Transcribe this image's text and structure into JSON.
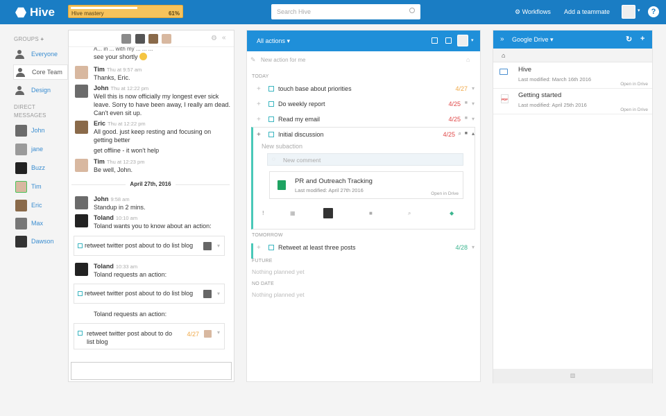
{
  "app": {
    "name": "Hive"
  },
  "topbar": {
    "mastery_label": "Hive mastery",
    "mastery_percent": "61%",
    "mastery_value": 0.61,
    "search_placeholder": "Search Hive",
    "workflows": "Workflows",
    "add_teammate": "Add a teammate",
    "help": "?"
  },
  "sidebar": {
    "groups_label": "GROUPS",
    "add_icon": "+",
    "groups": [
      {
        "label": "Everyone"
      },
      {
        "label": "Core Team"
      },
      {
        "label": "Design"
      }
    ],
    "dm_label_1": "DIRECT",
    "dm_label_2": "MESSAGES",
    "dms": [
      {
        "label": "John"
      },
      {
        "label": "jane"
      },
      {
        "label": "Buzz"
      },
      {
        "label": "Tim"
      },
      {
        "label": "Eric"
      },
      {
        "label": "Max"
      },
      {
        "label": "Dawson"
      }
    ]
  },
  "chat": {
    "partial_line1": "A... in ... with my ... ... ...",
    "partial_line2": "see your shortly",
    "messages": [
      {
        "name": "Tim",
        "time": "Thu at 9:57 am",
        "text": [
          "Thanks, Eric."
        ]
      },
      {
        "name": "John",
        "time": "Thu at 12:22 pm",
        "text": [
          "Well this is now officially my longest ever sick",
          "leave. Sorry to have been away, I really am dead.",
          "Can't even sit up."
        ]
      },
      {
        "name": "Eric",
        "time": "Thu at 12:22 pm",
        "text": [
          "All good. just keep resting and focusing on",
          "getting better"
        ]
      },
      {
        "name": "",
        "time": "",
        "text": [
          "get offline - it won't help"
        ]
      },
      {
        "name": "Tim",
        "time": "Thu at 12:23 pm",
        "text": [
          "Be well, John."
        ]
      }
    ],
    "day": "April 27th, 2016",
    "messages2": [
      {
        "name": "John",
        "time": "9:58 am",
        "text": "Standup in 2 mins."
      },
      {
        "name": "Toland",
        "time": "10:10 am",
        "text": "Toland wants you to know about an action:"
      }
    ],
    "card1": "retweet twitter post about to do list blog",
    "toland2_name": "Toland",
    "toland2_time": "10:33 am",
    "toland2_text": "Toland requests an action:",
    "card2": "retweet twitter post about to do list blog",
    "toland3_text": "Toland requests an action:",
    "card3_line1": "retweet twitter post about to do",
    "card3_line2": "list blog",
    "card3_due": "4/27"
  },
  "actions": {
    "title": "All actions",
    "new_placeholder": "New action for me",
    "today": "TODAY",
    "items": [
      {
        "label": "touch base about priorities",
        "due": "4/27",
        "color": "#f0a94a"
      },
      {
        "label": "Do weekly report",
        "due": "4/25",
        "color": "#e04848"
      },
      {
        "label": "Read my email",
        "due": "4/25",
        "color": "#e04848"
      },
      {
        "label": "Initial discussion",
        "due": "4/25",
        "color": "#e04848"
      }
    ],
    "new_subaction": "New subaction",
    "new_comment": "New comment",
    "attachment": {
      "name": "PR and Outreach Tracking",
      "modified": "Last modified: April 27th 2016",
      "open": "Open in Drive"
    },
    "tomorrow": "TOMORROW",
    "tomorrow_item": {
      "label": "Retweet at least three posts",
      "due": "4/28",
      "color": "#3bb58f"
    },
    "future": "FUTURE",
    "future_empty": "Nothing planned yet",
    "nodate": "NO DATE",
    "nodate_empty": "Nothing planned yet"
  },
  "drive": {
    "title": "Google Drive",
    "files": [
      {
        "name": "Hive",
        "modified": "Last modified: March 16th 2016",
        "open": "Open in Drive",
        "icon": "folder-icon"
      },
      {
        "name": "Getting started",
        "modified": "Last modified: April 25th 2016",
        "open": "Open in Drive",
        "icon": "pdf-icon"
      }
    ]
  },
  "colors": {
    "brand": "#1a7dc4",
    "accent": "#1f8fd9",
    "mastery": "#f6c35c",
    "teal": "#49c8b8"
  }
}
